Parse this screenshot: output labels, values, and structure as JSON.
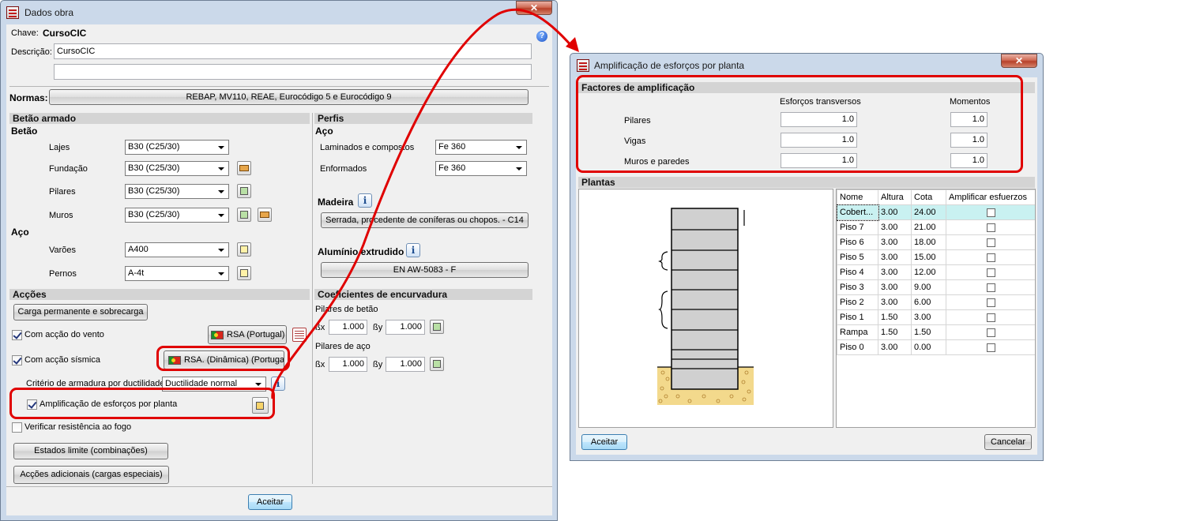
{
  "dialog1": {
    "title": "Dados obra",
    "close_glyph": "✕",
    "chave_label": "Chave:",
    "chave_value": "CursoCIC",
    "descricao_label": "Descrição:",
    "descricao_value": "CursoCIC",
    "descricao_value2": "",
    "normas_label": "Normas:",
    "normas_value": "REBAP, MV110, REAE, Eurocódigo 5 e Eurocódigo 9",
    "betao_armado": {
      "section": "Betão armado",
      "betao_heading": "Betão",
      "rows": [
        {
          "label": "Lajes",
          "value": "B30 (C25/30)"
        },
        {
          "label": "Fundação",
          "value": "B30 (C25/30)"
        },
        {
          "label": "Pilares",
          "value": "B30 (C25/30)"
        },
        {
          "label": "Muros",
          "value": "B30 (C25/30)"
        }
      ],
      "aco_heading": "Aço",
      "aco_rows": [
        {
          "label": "Varões",
          "value": "A400"
        },
        {
          "label": "Pernos",
          "value": "A-4t"
        }
      ]
    },
    "perfis": {
      "section": "Perfis",
      "aco_heading": "Aço",
      "rows": [
        {
          "label": "Laminados e compostos",
          "value": "Fe 360"
        },
        {
          "label": "Enformados",
          "value": "Fe 360"
        }
      ],
      "madeira_heading": "Madeira",
      "madeira_value": "Serrada, procedente de coníferas ou chopos. - C14",
      "aluminio_heading": "Alumínio extrudido",
      "aluminio_value": "EN AW-5083 - F"
    },
    "accoes": {
      "section": "Acções",
      "carga_button": "Carga permanente e sobrecarga",
      "vento_label": "Com acção do vento",
      "vento_checked": true,
      "vento_button": "RSA (Portugal)",
      "sismica_label": "Com acção sísmica",
      "sismica_checked": true,
      "sismica_button": "RSA. (Dinâmica) (Portugal)",
      "criterio_label": "Critério de armadura por ductilidade",
      "criterio_value": "Ductilidade normal",
      "amplificacao_label": "Amplificação de esforços por planta",
      "amplificacao_checked": true,
      "fogo_label": "Verificar resistência ao fogo",
      "fogo_checked": false,
      "estados_button": "Estados limite (combinações)",
      "accoes_adicionais_button": "Acções adicionais (cargas especiais)"
    },
    "coeficientes": {
      "section": "Coeficientes de encurvadura",
      "pilares_betao": "Pilares de betão",
      "pilares_aco": "Pilares de aço",
      "bx_label": "ßx",
      "by_label": "ßy",
      "betao_bx": "1.000",
      "betao_by": "1.000",
      "aco_bx": "1.000",
      "aco_by": "1.000"
    },
    "aceitar": "Aceitar"
  },
  "dialog2": {
    "title": "Amplificação de esforços por planta",
    "close_glyph": "✕",
    "factores": {
      "section": "Factores de amplificação",
      "col1": "Esforços transversos",
      "col2": "Momentos",
      "rows": [
        {
          "label": "Pilares",
          "transversos": "1.0",
          "momentos": "1.0"
        },
        {
          "label": "Vigas",
          "transversos": "1.0",
          "momentos": "1.0"
        },
        {
          "label": "Muros e paredes",
          "transversos": "1.0",
          "momentos": "1.0"
        }
      ]
    },
    "plantas": {
      "section": "Plantas",
      "headers": [
        "Nome",
        "Altura",
        "Cota",
        "Amplificar esfuerzos"
      ],
      "rows": [
        {
          "nome": "Cobert...",
          "altura": "3.00",
          "cota": "24.00",
          "amplificar": false,
          "selected": true
        },
        {
          "nome": "Piso 7",
          "altura": "3.00",
          "cota": "21.00",
          "amplificar": false
        },
        {
          "nome": "Piso 6",
          "altura": "3.00",
          "cota": "18.00",
          "amplificar": false
        },
        {
          "nome": "Piso 5",
          "altura": "3.00",
          "cota": "15.00",
          "amplificar": false
        },
        {
          "nome": "Piso 4",
          "altura": "3.00",
          "cota": "12.00",
          "amplificar": false
        },
        {
          "nome": "Piso 3",
          "altura": "3.00",
          "cota": "9.00",
          "amplificar": false
        },
        {
          "nome": "Piso 2",
          "altura": "3.00",
          "cota": "6.00",
          "amplificar": false
        },
        {
          "nome": "Piso 1",
          "altura": "1.50",
          "cota": "3.00",
          "amplificar": false
        },
        {
          "nome": "Rampa",
          "altura": "1.50",
          "cota": "1.50",
          "amplificar": false
        },
        {
          "nome": "Piso 0",
          "altura": "3.00",
          "cota": "0.00",
          "amplificar": false
        }
      ]
    },
    "aceitar": "Aceitar",
    "cancelar": "Cancelar"
  },
  "colors": {
    "annotation_red": "#e00000",
    "section_gray": "#d4d4d4",
    "frame_blue": "#cbd9ea",
    "selected_row": "#c9f1f1",
    "ground_sand": "#f3d98c"
  },
  "icons": [
    "app-icon",
    "close-icon",
    "help-icon",
    "info-icon",
    "portugal-flag-icon",
    "edit-icon",
    "folder-icon",
    "table-icon"
  ]
}
